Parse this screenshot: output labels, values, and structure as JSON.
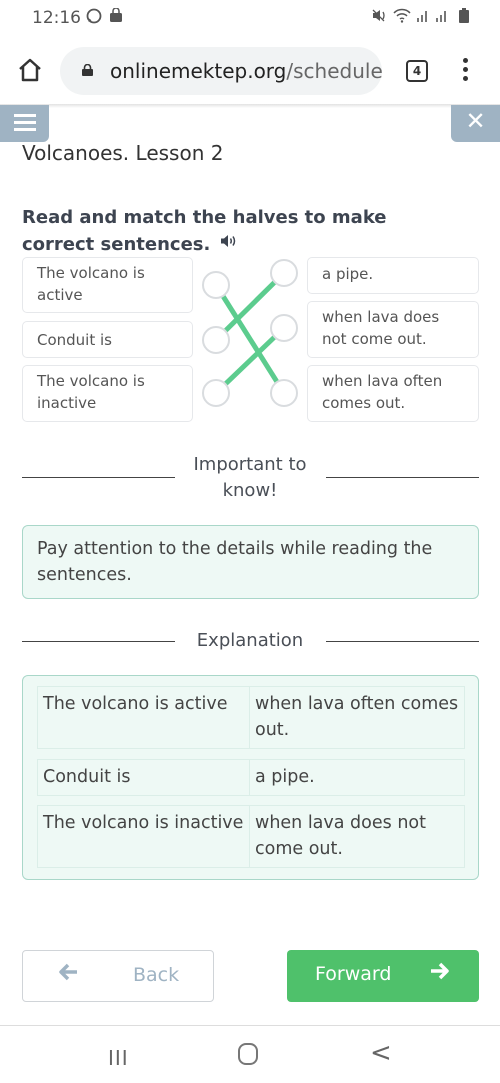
{
  "statusbar": {
    "time": "12:16",
    "icons": [
      "whatsapp-icon",
      "bag-icon",
      "mute-icon",
      "wifi-icon",
      "signal-icon",
      "signal-icon",
      "battery-icon"
    ]
  },
  "browser": {
    "url_domain": "onlinemektep.org",
    "url_path": "/schedule",
    "tab_count": "4"
  },
  "header": {
    "menu_icon": "hamburger-icon",
    "close_label": "✕"
  },
  "lesson": {
    "title": "Volcanoes. Lesson 2",
    "task": "Read and match the halves to make correct sentences.",
    "speaker_glyph": "🔊"
  },
  "matching": {
    "left": [
      {
        "text": "The volcano is active"
      },
      {
        "text": "Conduit is"
      },
      {
        "text": "The volcano is inactive"
      }
    ],
    "right": [
      {
        "text": "a pipe."
      },
      {
        "text": "when lava does not come out."
      },
      {
        "text": "when lava often comes out."
      }
    ],
    "connections": [
      [
        0,
        2
      ],
      [
        1,
        0
      ],
      [
        2,
        1
      ]
    ],
    "line_color": "#5ccc8e"
  },
  "important": {
    "heading": "Important to know!",
    "text": "Pay attention to the details while reading the sentences."
  },
  "explanation": {
    "heading": "Explanation",
    "rows": [
      [
        "The volcano is active",
        "when lava often comes out."
      ],
      [
        "Conduit is",
        "a pipe."
      ],
      [
        "The volcano is inactive",
        "when lava does not come out."
      ]
    ]
  },
  "footer": {
    "back_label": "Back",
    "back_arrow": "🡐",
    "forward_label": "Forward",
    "forward_arrow": "➔",
    "forward_color": "#4fc16b"
  },
  "navbar": {
    "recents": "III",
    "back": "<"
  }
}
